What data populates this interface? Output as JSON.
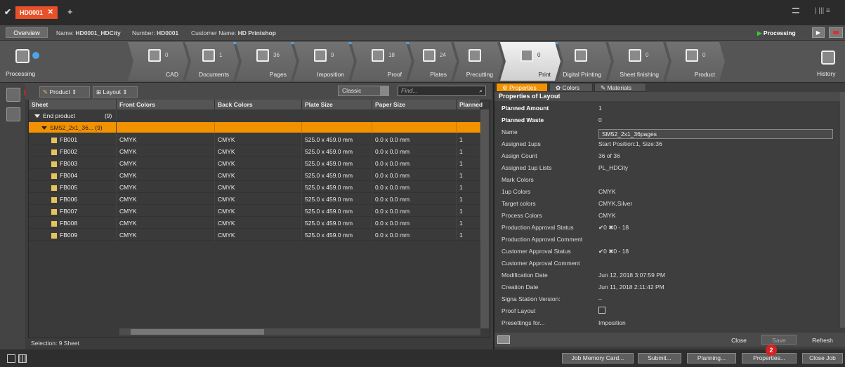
{
  "tabs": {
    "job_tab": "HD0001",
    "close": "✕",
    "add": "+"
  },
  "infobar": {
    "overview": "Overview",
    "name_label": "Name:",
    "name": "HD0001_HDCity",
    "number_label": "Number:",
    "number": "HD0001",
    "customer_label": "Customer Name:",
    "customer": "HD Printshop",
    "status": "Processing"
  },
  "workflow": {
    "left_label": "Processing",
    "right_label": "History",
    "steps": [
      {
        "label": "CAD",
        "count": "0"
      },
      {
        "label": "Documents",
        "count": "1"
      },
      {
        "label": "Pages",
        "count": "36"
      },
      {
        "label": "Imposition",
        "count": "9"
      },
      {
        "label": "Proof",
        "count": "18"
      },
      {
        "label": "Plates",
        "count": "24"
      },
      {
        "label": "Precutting",
        "count": ""
      },
      {
        "label": "Print",
        "count": "0"
      },
      {
        "label": "Digital Printing",
        "count": ""
      },
      {
        "label": "Sheet finishing",
        "count": "0"
      },
      {
        "label": "Product",
        "count": "0"
      }
    ]
  },
  "toolbar": {
    "product": "Product",
    "layout": "Layout",
    "view": "Classic",
    "find_placeholder": "Find..."
  },
  "table": {
    "headers": [
      "Sheet",
      "Front Colors",
      "Back Colors",
      "Plate Size",
      "Paper Size",
      "Planned"
    ],
    "end_product": "End product",
    "end_count": "(9)",
    "layout_row": "SM52_2x1_36...",
    "layout_count": "(9)",
    "rows": [
      [
        "FB001",
        "CMYK",
        "CMYK",
        "525.0 x 459.0 mm",
        "0.0 x 0.0 mm",
        "1"
      ],
      [
        "FB002",
        "CMYK",
        "CMYK",
        "525.0 x 459.0 mm",
        "0.0 x 0.0 mm",
        "1"
      ],
      [
        "FB003",
        "CMYK",
        "CMYK",
        "525.0 x 459.0 mm",
        "0.0 x 0.0 mm",
        "1"
      ],
      [
        "FB004",
        "CMYK",
        "CMYK",
        "525.0 x 459.0 mm",
        "0.0 x 0.0 mm",
        "1"
      ],
      [
        "FB005",
        "CMYK",
        "CMYK",
        "525.0 x 459.0 mm",
        "0.0 x 0.0 mm",
        "1"
      ],
      [
        "FB006",
        "CMYK",
        "CMYK",
        "525.0 x 459.0 mm",
        "0.0 x 0.0 mm",
        "1"
      ],
      [
        "FB007",
        "CMYK",
        "CMYK",
        "525.0 x 459.0 mm",
        "0.0 x 0.0 mm",
        "1"
      ],
      [
        "FB008",
        "CMYK",
        "CMYK",
        "525.0 x 459.0 mm",
        "0.0 x 0.0 mm",
        "1"
      ],
      [
        "FB009",
        "CMYK",
        "CMYK",
        "525.0 x 459.0 mm",
        "0.0 x 0.0 mm",
        "1"
      ]
    ],
    "selection": "Selection: 9 Sheet"
  },
  "props": {
    "tabs": [
      "Properties",
      "Colors",
      "Materials"
    ],
    "title": "Properties of Layout",
    "rows": [
      {
        "k": "Planned Amount",
        "v": "1"
      },
      {
        "k": "Planned Waste",
        "v": "0"
      },
      {
        "k": "Name",
        "v": ""
      },
      {
        "k": "Assigned 1ups",
        "v": "Start Position:1, Size:36"
      },
      {
        "k": "Assign Count",
        "v": "36 of 36"
      },
      {
        "k": "Assigned 1up Lists",
        "v": "PL_HDCity"
      },
      {
        "k": "Mark Colors",
        "v": ""
      },
      {
        "k": "1up Colors",
        "v": "CMYK"
      },
      {
        "k": "Target colors",
        "v": "CMYK,Silver"
      },
      {
        "k": "Process Colors",
        "v": "CMYK"
      },
      {
        "k": "Production Approval Status",
        "v": "✔0  ✖0  - 18"
      },
      {
        "k": "Production Approval Comment",
        "v": ""
      },
      {
        "k": "Customer Approval Status",
        "v": "✔0  ✖0  - 18"
      },
      {
        "k": "Customer Approval Comment",
        "v": ""
      },
      {
        "k": "Modification Date",
        "v": "Jun 12, 2018 3:07:59 PM"
      },
      {
        "k": "Creation Date",
        "v": "Jun 11, 2018 2:11:42 PM"
      },
      {
        "k": "Signa Station Version:",
        "v": "–"
      },
      {
        "k": "Proof Layout",
        "v": ""
      },
      {
        "k": "Presettings for...",
        "v": "Imposition"
      }
    ],
    "name_value": "SM52_2x1_36pages",
    "buttons": {
      "close": "Close",
      "save": "Save",
      "refresh": "Refresh"
    }
  },
  "badges": {
    "b1": "1",
    "b2": "2"
  },
  "statusbar": {
    "buttons": [
      "Job Memory Card...",
      "Submit...",
      "Planning...",
      "Properties...",
      "Close Job"
    ]
  }
}
